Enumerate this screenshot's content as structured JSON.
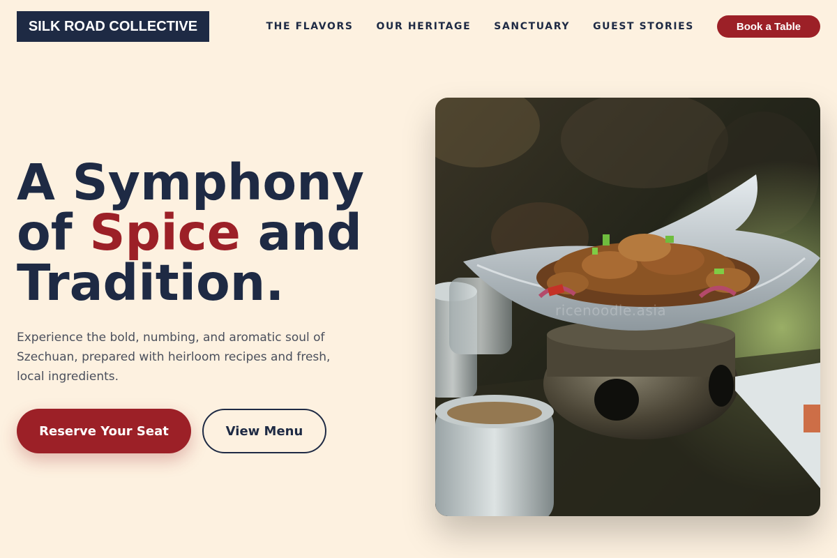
{
  "brand": {
    "name": "SILK ROAD COLLECTIVE"
  },
  "nav": {
    "links": [
      "THE FLAVORS",
      "OUR HERITAGE",
      "SANCTUARY",
      "GUEST STORIES"
    ],
    "cta_label": "Book a Table"
  },
  "hero": {
    "title_line1": "A Symphony",
    "title_of": "of",
    "title_accent": "Spice",
    "title_and": "and",
    "title_line3": "Tradition.",
    "subtitle": "Experience the bold, numbing, and aromatic soul of Szechuan, prepared with heirloom recipes and fresh, local ingredients.",
    "primary_button": "Reserve Your Seat",
    "secondary_button": "View Menu"
  },
  "image": {
    "subject": "spicy stir-fried dish on a white bowl over a tabletop warmer",
    "watermark": "ricenoodle.asia"
  },
  "colors": {
    "background": "#fdf1e0",
    "navy": "#1e2a44",
    "accent": "#9c2027",
    "body_text": "#4a4f5c"
  }
}
